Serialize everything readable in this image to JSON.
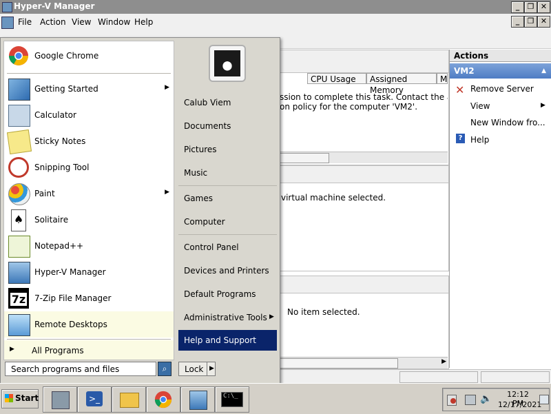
{
  "window": {
    "title": "Hyper-V Manager"
  },
  "menubar": {
    "items": [
      "File",
      "Action",
      "View",
      "Window",
      "Help"
    ]
  },
  "center": {
    "columns": [
      "CPU Usage",
      "Assigned Memory",
      "M"
    ],
    "message_line1": "ssion to complete this task. Contact the administrato",
    "message_line2": "on policy for the computer 'VM2'.",
    "vm_message": "virtual machine selected.",
    "item_message": "No item selected."
  },
  "actions": {
    "title": "Actions",
    "section": "VM2",
    "items": [
      "Remove Server",
      "View",
      "New Window fro...",
      "Help"
    ]
  },
  "startmenu": {
    "programs": [
      {
        "label": "Google Chrome",
        "icon": "chrome-icon"
      },
      {
        "label": "Getting Started",
        "icon": "getting-started-icon",
        "submenu": true
      },
      {
        "label": "Calculator",
        "icon": "calculator-icon"
      },
      {
        "label": "Sticky Notes",
        "icon": "sticky-notes-icon"
      },
      {
        "label": "Snipping Tool",
        "icon": "snipping-tool-icon"
      },
      {
        "label": "Paint",
        "icon": "paint-icon",
        "submenu": true
      },
      {
        "label": "Solitaire",
        "icon": "solitaire-icon"
      },
      {
        "label": "Notepad++",
        "icon": "notepad-plus-plus-icon"
      },
      {
        "label": "Hyper-V Manager",
        "icon": "hyper-v-icon"
      },
      {
        "label": "7-Zip File Manager",
        "icon": "seven-zip-icon"
      },
      {
        "label": "Remote Desktops",
        "icon": "remote-desktops-icon"
      }
    ],
    "all_programs": "All Programs",
    "search_placeholder": "Search programs and files",
    "right_links": [
      "Calub Viem",
      "Documents",
      "Pictures",
      "Music",
      "Games",
      "Computer",
      "Control Panel",
      "Devices and Printers",
      "Default Programs",
      "Administrative Tools",
      "Help and Support"
    ],
    "lock_label": "Lock",
    "highlight_color": "#0a246a"
  },
  "taskbar": {
    "start_label": "Start",
    "time": "12:12 PM",
    "date": "12/17/2021"
  }
}
